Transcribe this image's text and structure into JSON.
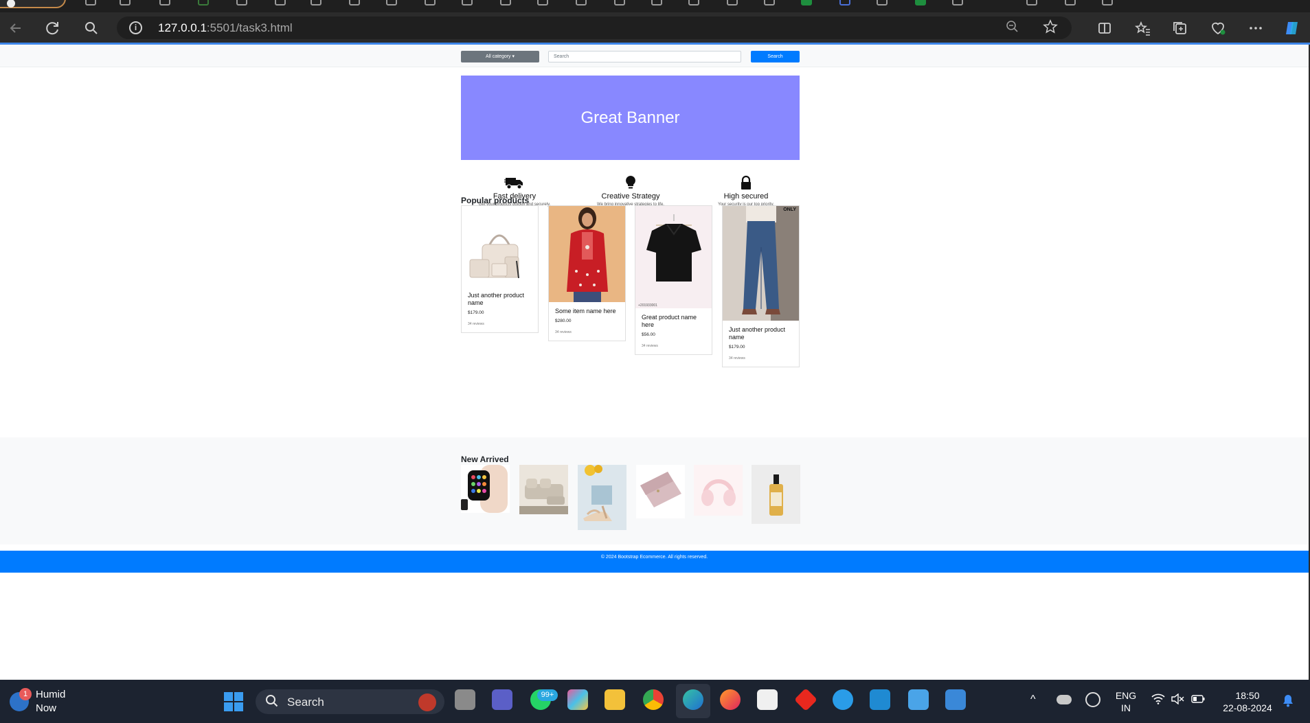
{
  "browser": {
    "url_host": "127.0.0.1",
    "url_rest": ":5501/task3.html"
  },
  "navbar": {
    "category_button": "All category ▾",
    "search_placeholder": "Search",
    "search_button": "Search"
  },
  "banner": {
    "title": "Great Banner"
  },
  "features": [
    {
      "icon": "truck-icon",
      "title": "Fast delivery",
      "desc": "Get your products quickly and securely."
    },
    {
      "icon": "lightbulb-icon",
      "title": "Creative Strategy",
      "desc": "We bring innovative strategies to life."
    },
    {
      "icon": "lock-icon",
      "title": "High secured",
      "desc": "Your security is our top priority."
    }
  ],
  "popular": {
    "title": "Popular products",
    "products": [
      {
        "name": "Just another product name",
        "price": "$179.00",
        "reviews": "34 reviews"
      },
      {
        "name": "Some item name here",
        "price": "$280.00",
        "reviews": "34 reviews"
      },
      {
        "name": "Great product name here",
        "price": "$56.00",
        "reviews": "34 reviews"
      },
      {
        "name": "Just another product name",
        "price": "$179.00",
        "reviews": "34 reviews"
      }
    ],
    "brand_tag": "ONLY"
  },
  "new_arrived": {
    "title": "New Arrived"
  },
  "footer": {
    "text": "© 2024 Bootstrap Ecommerce. All rights reserved."
  },
  "taskbar": {
    "weather_title": "Humid",
    "weather_sub": "Now",
    "weather_badge": "1",
    "search_label": "Search",
    "whatsapp_badge": "99+",
    "lang_top": "ENG",
    "lang_bottom": "IN",
    "time": "18:50",
    "date": "22-08-2024"
  }
}
